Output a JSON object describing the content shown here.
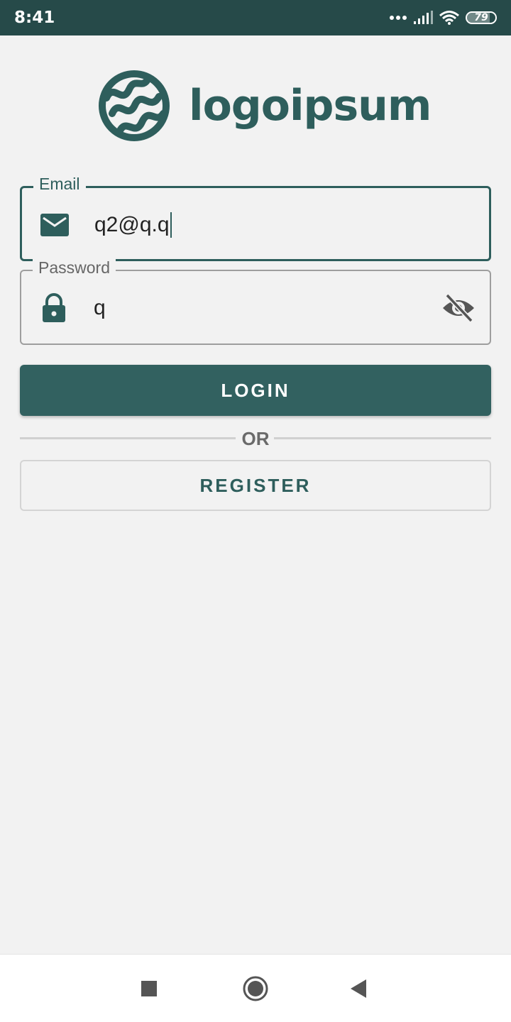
{
  "status_bar": {
    "time": "8:41",
    "battery_level": "79",
    "battery_fraction": 0.79,
    "icons": [
      "more-dots-icon",
      "signal-icon",
      "wifi-icon",
      "battery-icon"
    ]
  },
  "brand": {
    "logo_text": "logoipsum",
    "logo_icon": "logo-mark-icon",
    "color": "#2e5e5c"
  },
  "form": {
    "email": {
      "label": "Email",
      "value": "q2@q.q",
      "icon": "mail-icon",
      "focused": true
    },
    "password": {
      "label": "Password",
      "value": "q",
      "icon": "lock-icon",
      "toggle_icon": "eye-off-icon"
    },
    "login_label": "LOGIN",
    "divider_text": "OR",
    "register_label": "REGISTER"
  },
  "nav_bar": {
    "icons": [
      "recent-apps-icon",
      "home-icon",
      "back-icon"
    ]
  },
  "colors": {
    "accent": "#2e5e5c",
    "button": "#326160",
    "status_bar": "#264a49",
    "background": "#f2f2f2"
  }
}
